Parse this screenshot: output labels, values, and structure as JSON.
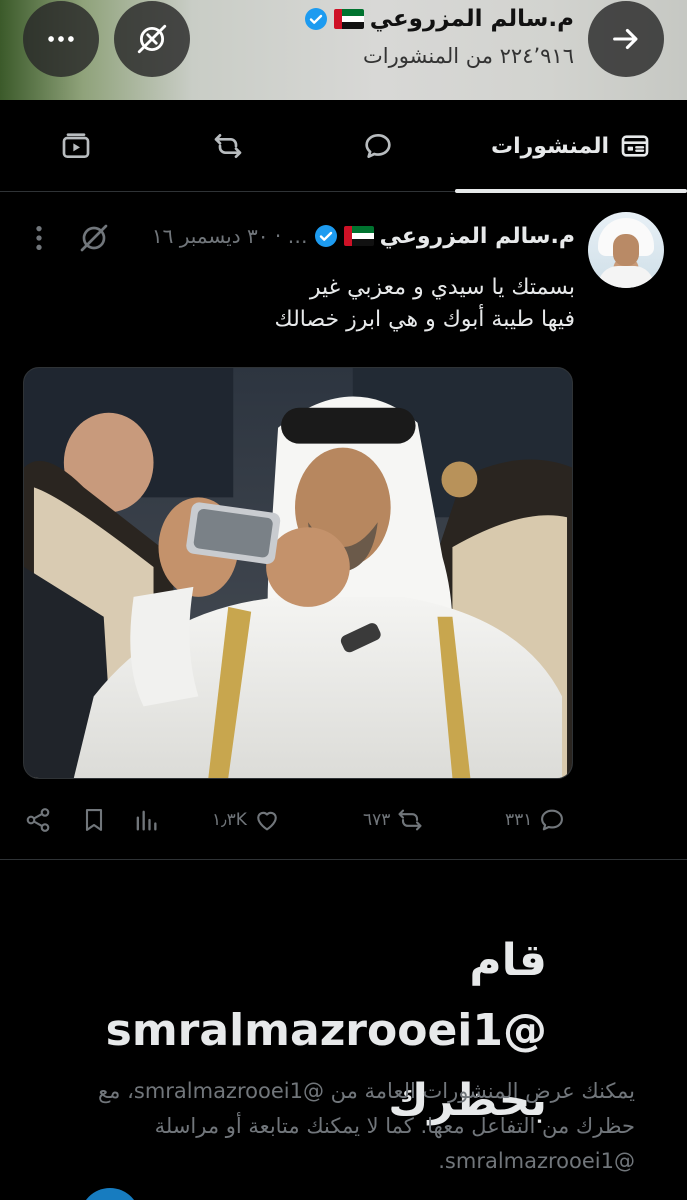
{
  "header": {
    "display_name": "م.سالم المزروعي",
    "post_count_text": "٢٢٤٬٩١٦ من المنشورات",
    "icons": {
      "back": "arrow-icon",
      "mute": "muted-icon",
      "more": "more-dots-icon",
      "verified": "verified-badge-icon",
      "flag": "uae-flag-icon"
    }
  },
  "tabs": [
    {
      "label": "المنشورات",
      "icon": "posts-tab-icon",
      "active": true
    },
    {
      "label": "",
      "icon": "reply-icon",
      "active": false
    },
    {
      "label": "",
      "icon": "repost-icon",
      "active": false
    },
    {
      "label": "",
      "icon": "media-icon",
      "active": false
    }
  ],
  "post": {
    "author_name": "م.سالم المزروعي",
    "handle_truncated": "…",
    "date": "١٦ ديسمبر ٢٠٣٠",
    "date_display": "… · ٣٠ ديسمبر ١٦",
    "text": "بسمتك يا سيدي و معزبي غير\nفيها طيبة أبوك و هي ابرز خصالك",
    "image_icon": "photo-image",
    "stats": {
      "replies": "٣٣١",
      "reposts": "٦٧٣",
      "likes": "١٫٣K",
      "views": ""
    }
  },
  "blocked": {
    "title": "قام @smralmazrooei1 بحظرك",
    "description": "يمكنك عرض المنشورات العامة من @smralmazrooei1، مع حظرك من التفاعل معها. كما لا يمكنك متابعة أو مراسلة @smralmazrooei1."
  },
  "colors": {
    "background": "#000000",
    "text_primary": "#e7e9ea",
    "text_secondary": "#71767b",
    "verified": "#1d9bf0",
    "divider": "#2f3336"
  }
}
